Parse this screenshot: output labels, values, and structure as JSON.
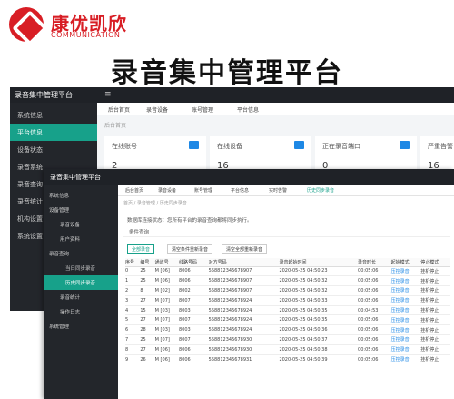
{
  "brand": {
    "name_cn": "康优凯欣",
    "name_en": "COMMUNICATION"
  },
  "headline": "录音集中管理平台",
  "back_window": {
    "app_title": "录音集中管理平台",
    "menu_icon": "≡",
    "sidebar": [
      "平台信息",
      "设备状态",
      "录音系统",
      "录音查询",
      "录音统计"
    ],
    "sidebar_extra": [
      "机构设置",
      "系统设置"
    ],
    "active_sidebar": "平台信息",
    "header_item": "系统信息",
    "tabs": [
      "后台首页",
      "录音设备",
      "账号管理",
      "平台信息"
    ],
    "breadcrumb": "后台首页",
    "cards": [
      {
        "label": "在线账号",
        "value": "2"
      },
      {
        "label": "在线设备",
        "value": "16"
      },
      {
        "label": "正在录音端口",
        "value": "0"
      },
      {
        "label": "严重告警",
        "value": "16"
      }
    ]
  },
  "front_window": {
    "app_title": "录音集中管理平台",
    "sidebar": [
      "系统信息",
      "设备管理",
      "录音设备",
      "用户资料",
      "录音查询",
      "当日同步录音",
      "历史同步录音",
      "录音统计",
      "操作日志",
      "系统管理"
    ],
    "active_sidebar": "历史同步录音",
    "tabs": [
      "后台首页",
      "录音设备",
      "账号管理",
      "平台信息",
      "实时告警",
      "历史同步录音"
    ],
    "active_tab": "历史同步录音",
    "breadcrumb": "首页 / 录音管理 / 历史同步录音",
    "note": "数据库连接状态：您所有平台的录音查询都将同步执行。",
    "filter_label": "条件查询",
    "buttons": [
      "全部录音",
      "清空条件重新录音",
      "清空全部重新录音"
    ],
    "columns": [
      "序号",
      "编号",
      "通道号",
      "线路号码",
      "对方号码",
      "录音起始时间",
      "录音时长",
      "起始模式",
      "停止模式"
    ],
    "rows": [
      [
        "0",
        "25",
        "M [06]",
        "8006",
        "558812345678907",
        "2020-05-25 04:50:23",
        "00:05:06",
        "压控录音",
        "挂机停止"
      ],
      [
        "1",
        "25",
        "M [06]",
        "8006",
        "558812345678907",
        "2020-05-25 04:50:32",
        "00:05:06",
        "压控录音",
        "挂机停止"
      ],
      [
        "2",
        "8",
        "M [02]",
        "8002",
        "558812345678907",
        "2020-05-25 04:50:32",
        "00:05:06",
        "压控录音",
        "挂机停止"
      ],
      [
        "3",
        "27",
        "M [07]",
        "8007",
        "558812345678924",
        "2020-05-25 04:50:33",
        "00:05:06",
        "压控录音",
        "挂机停止"
      ],
      [
        "4",
        "15",
        "M [03]",
        "8003",
        "558812345678924",
        "2020-05-25 04:50:35",
        "00:04:53",
        "压控录音",
        "挂机停止"
      ],
      [
        "5",
        "27",
        "M [07]",
        "8007",
        "558812345678924",
        "2020-05-25 04:50:35",
        "00:05:06",
        "压控录音",
        "挂机停止"
      ],
      [
        "6",
        "28",
        "M [03]",
        "8003",
        "558812345678924",
        "2020-05-25 04:50:36",
        "00:05:06",
        "压控录音",
        "挂机停止"
      ],
      [
        "7",
        "25",
        "M [07]",
        "8007",
        "558812345678930",
        "2020-05-25 04:50:37",
        "00:05:06",
        "压控录音",
        "挂机停止"
      ],
      [
        "8",
        "27",
        "M [06]",
        "8006",
        "558812345678930",
        "2020-05-25 04:50:38",
        "00:05:06",
        "压控录音",
        "挂机停止"
      ],
      [
        "9",
        "26",
        "M [06]",
        "8006",
        "558812345678931",
        "2020-05-25 04:50:39",
        "00:05:06",
        "压控录音",
        "挂机停止"
      ]
    ]
  },
  "colors": {
    "accent": "#17a18a",
    "brand": "#d81e25",
    "sidebar": "#23262b"
  }
}
